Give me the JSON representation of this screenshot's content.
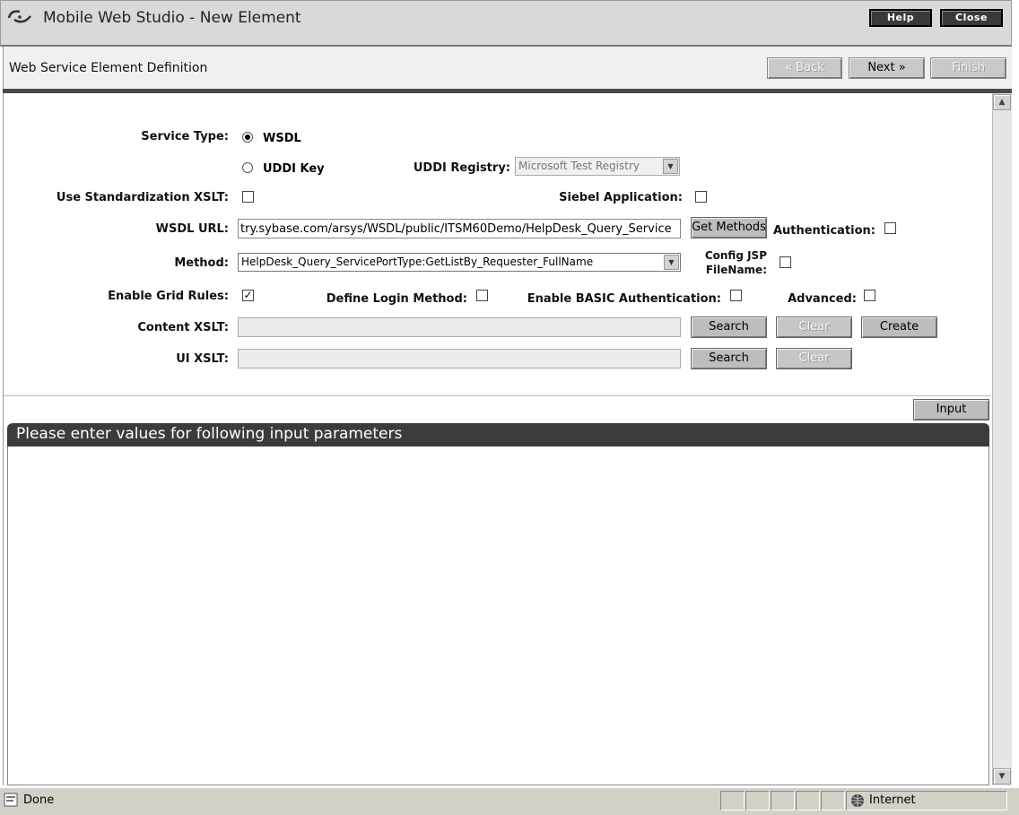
{
  "window": {
    "title": "Mobile Web Studio - New Element",
    "help_label": "Help",
    "close_label": "Close"
  },
  "wizard": {
    "title": "Web Service Element Definition",
    "back_label": "« Back",
    "next_label": "Next »",
    "finish_label": "Finish"
  },
  "form": {
    "service_type_label": "Service Type:",
    "service_type_options": [
      "WSDL",
      "UDDI Key"
    ],
    "service_type_selected": "WSDL",
    "uddi_registry_label": "UDDI Registry:",
    "uddi_registry_value": "Microsoft Test Registry",
    "use_std_xslt_label": "Use Standardization XSLT:",
    "use_std_xslt_checked": false,
    "siebel_label": "Siebel Application:",
    "siebel_checked": false,
    "wsdl_url_label": "WSDL URL:",
    "wsdl_url_value": "try.sybase.com/arsys/WSDL/public/ITSM60Demo/HelpDesk_Query_Service",
    "get_methods_label": "Get Methods",
    "authentication_label": "Authentication:",
    "authentication_checked": false,
    "method_label": "Method:",
    "method_value": "HelpDesk_Query_ServicePortType:GetListBy_Requester_FullName",
    "config_jsp_label_line1": "Config JSP",
    "config_jsp_label_line2": "FileName:",
    "config_jsp_checked": false,
    "enable_grid_label": "Enable Grid Rules:",
    "enable_grid_checked": true,
    "define_login_label": "Define Login Method:",
    "define_login_checked": false,
    "enable_basic_label": "Enable BASIC Authentication:",
    "enable_basic_checked": false,
    "advanced_label": "Advanced:",
    "advanced_checked": false,
    "content_xslt_label": "Content XSLT:",
    "content_xslt_value": "",
    "ui_xslt_label": "UI XSLT:",
    "ui_xslt_value": "",
    "search_label": "Search",
    "clear_label": "Clear",
    "create_label": "Create"
  },
  "params": {
    "input_label": "Input",
    "title": "Please enter values for following input parameters"
  },
  "status": {
    "text": "Done",
    "zone": "Internet"
  }
}
